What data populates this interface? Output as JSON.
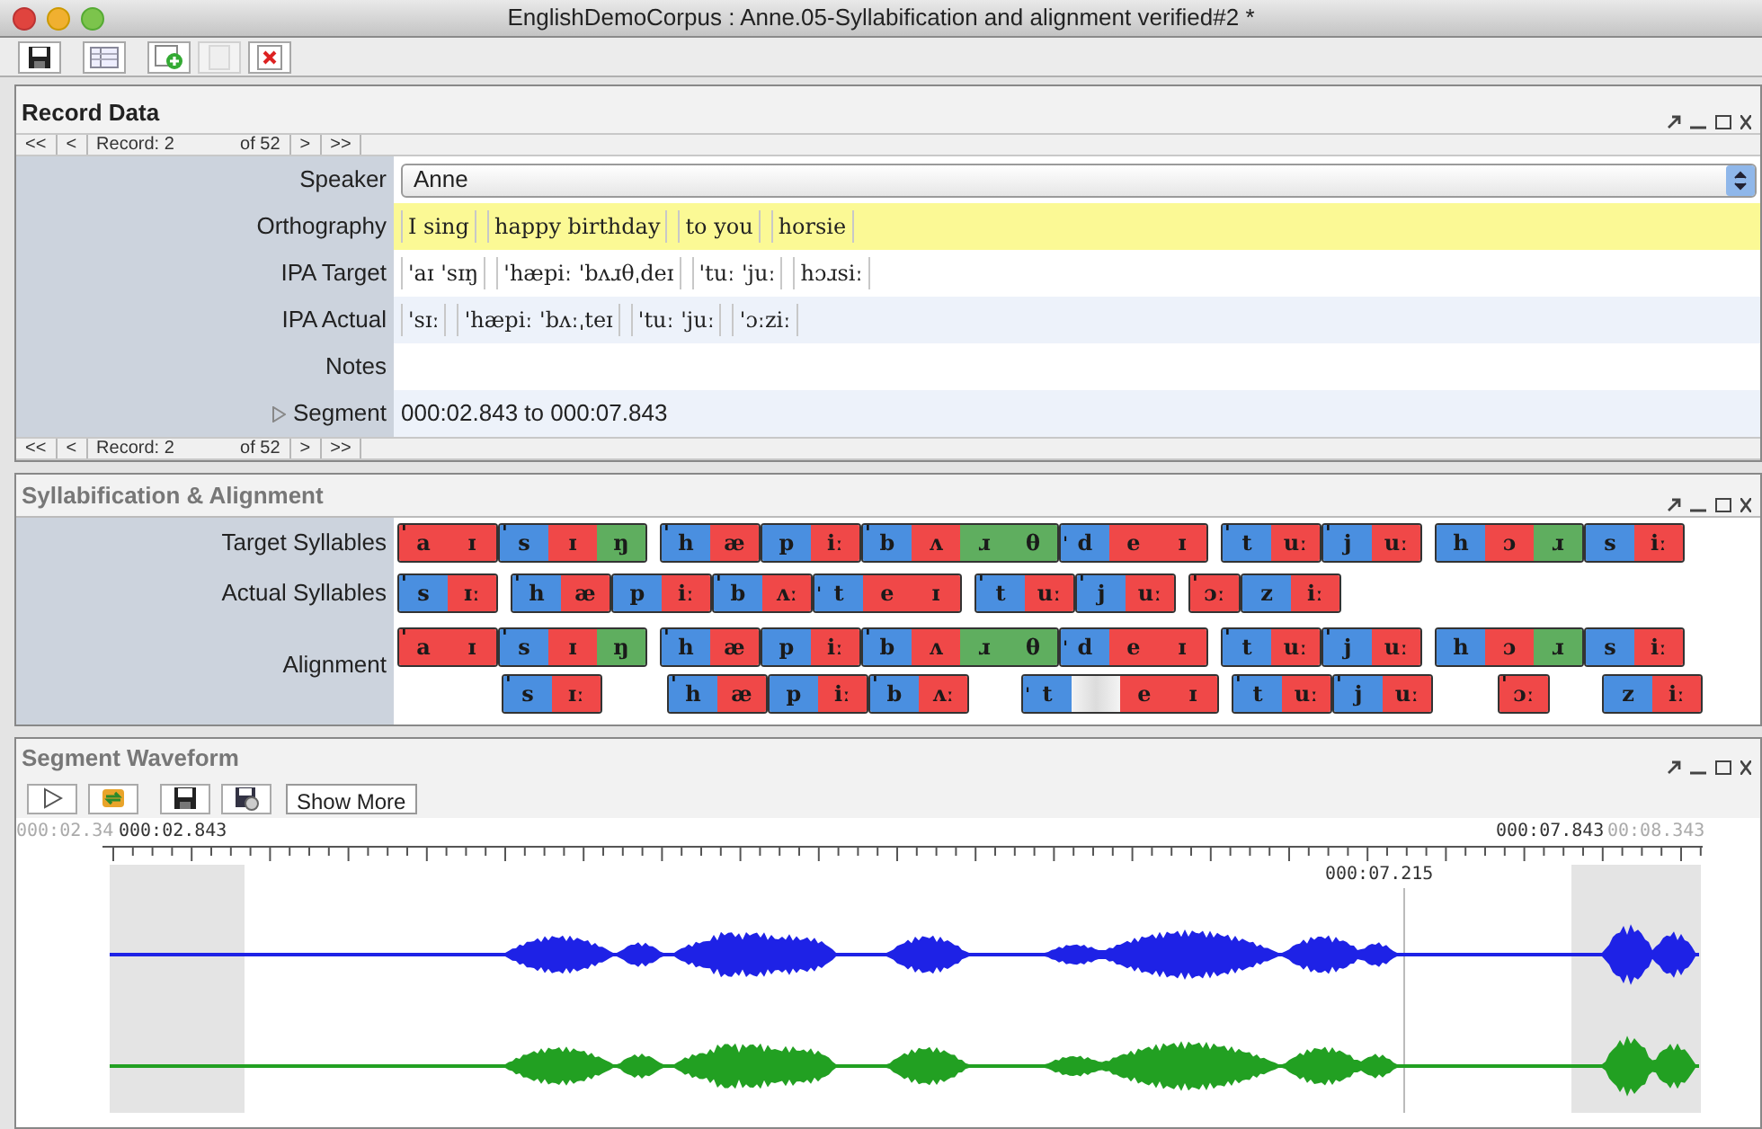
{
  "window": {
    "title": "EnglishDemoCorpus : Anne.05-Syllabification and alignment verified#2 *"
  },
  "toolbar": [
    {
      "kind": "save",
      "disabled": false
    },
    {
      "kind": "layout",
      "disabled": false
    },
    {
      "kind": "add",
      "disabled": false
    },
    {
      "kind": "document",
      "disabled": true
    },
    {
      "kind": "delete",
      "disabled": false
    }
  ],
  "record_panel": {
    "title": "Record Data",
    "nav_top": {
      "first": "<<",
      "prev": "<",
      "record": "Record: 2",
      "total": "of 52",
      "next": ">",
      "last": ">>"
    },
    "fields": [
      {
        "kind": "dropdown",
        "label": "Speaker",
        "value": "Anne",
        "highlighted": false
      },
      {
        "kind": "groups",
        "label": "Orthography",
        "groups": [
          "I sing",
          "happy birthday",
          "to you",
          "horsie"
        ],
        "highlighted": true
      },
      {
        "kind": "groups",
        "label": "IPA Target",
        "groups": [
          "'aɪ 'sɪŋ",
          "'hæpiː 'bʌɹθˌdeɪ",
          "'tuː 'juː",
          "hɔɹsiː"
        ],
        "highlighted": false
      },
      {
        "kind": "groups",
        "label": "IPA Actual",
        "groups": [
          "'sɪː",
          "'hæpiː 'bʌːˌteɪ",
          "'tuː 'juː",
          "'ɔːziː"
        ],
        "highlighted": false
      },
      {
        "kind": "text",
        "label": "Notes",
        "highlighted": false
      },
      {
        "kind": "segment",
        "label": "Segment",
        "value": "000:02.843 to 000:07.843",
        "expanded": false,
        "highlighted": false
      }
    ],
    "nav_bottom": {
      "first": "<<",
      "prev": "<",
      "record": "Record: 2",
      "total": "of 52",
      "next": ">",
      "last": ">>"
    }
  },
  "syllabification_panel": {
    "title": "Syllabification & Alignment",
    "target": {
      "label": "Target Syllables",
      "words": [
        [
          {
            "stress": "'",
            "phones": [
              {
                "text": "a",
                "color": "#f04848"
              },
              {
                "text": "ɪ",
                "color": "#f04848"
              }
            ]
          },
          {
            "stress": "'",
            "phones": [
              {
                "text": "s",
                "color": "#4a8fe0"
              },
              {
                "text": "ɪ",
                "color": "#f04848"
              },
              {
                "text": "ŋ",
                "color": "#5fae5f"
              }
            ]
          }
        ],
        [
          {
            "stress": "'",
            "phones": [
              {
                "text": "h",
                "color": "#4a8fe0"
              },
              {
                "text": "æ",
                "color": "#f04848"
              }
            ]
          },
          {
            "phones": [
              {
                "text": "p",
                "color": "#4a8fe0"
              },
              {
                "text": "iː",
                "color": "#f04848"
              }
            ]
          },
          {
            "stress": "'",
            "phones": [
              {
                "text": "b",
                "color": "#4a8fe0"
              },
              {
                "text": "ʌ",
                "color": "#f04848"
              },
              {
                "text": "ɹ",
                "color": "#5fae5f"
              },
              {
                "text": "θ",
                "color": "#5fae5f"
              }
            ]
          },
          {
            "stress": "ˌ",
            "phones": [
              {
                "text": "d",
                "color": "#4a8fe0"
              },
              {
                "text": "e",
                "color": "#f04848"
              },
              {
                "text": "ɪ",
                "color": "#f04848"
              }
            ]
          }
        ],
        [
          {
            "stress": "'",
            "phones": [
              {
                "text": "t",
                "color": "#4a8fe0"
              },
              {
                "text": "uː",
                "color": "#f04848"
              }
            ]
          },
          {
            "stress": "'",
            "phones": [
              {
                "text": "j",
                "color": "#4a8fe0"
              },
              {
                "text": "uː",
                "color": "#f04848"
              }
            ]
          }
        ],
        [
          {
            "phones": [
              {
                "text": "h",
                "color": "#4a8fe0"
              },
              {
                "text": "ɔ",
                "color": "#f04848"
              },
              {
                "text": "ɹ",
                "color": "#5fae5f"
              }
            ]
          },
          {
            "phones": [
              {
                "text": "s",
                "color": "#4a8fe0"
              },
              {
                "text": "iː",
                "color": "#f04848"
              }
            ]
          }
        ]
      ]
    },
    "actual": {
      "label": "Actual Syllables",
      "words": [
        [
          {
            "stress": "'",
            "phones": [
              {
                "text": "s",
                "color": "#4a8fe0"
              },
              {
                "text": "ɪː",
                "color": "#f04848"
              }
            ]
          }
        ],
        [
          {
            "stress": "'",
            "phones": [
              {
                "text": "h",
                "color": "#4a8fe0"
              },
              {
                "text": "æ",
                "color": "#f04848"
              }
            ]
          },
          {
            "phones": [
              {
                "text": "p",
                "color": "#4a8fe0"
              },
              {
                "text": "iː",
                "color": "#f04848"
              }
            ]
          },
          {
            "stress": "'",
            "phones": [
              {
                "text": "b",
                "color": "#4a8fe0"
              },
              {
                "text": "ʌː",
                "color": "#f04848"
              }
            ]
          },
          {
            "stress": "ˌ",
            "phones": [
              {
                "text": "t",
                "color": "#4a8fe0"
              },
              {
                "text": "e",
                "color": "#f04848"
              },
              {
                "text": "ɪ",
                "color": "#f04848"
              }
            ]
          }
        ],
        [
          {
            "stress": "'",
            "phones": [
              {
                "text": "t",
                "color": "#4a8fe0"
              },
              {
                "text": "uː",
                "color": "#f04848"
              }
            ]
          },
          {
            "stress": "'",
            "phones": [
              {
                "text": "j",
                "color": "#4a8fe0"
              },
              {
                "text": "uː",
                "color": "#f04848"
              }
            ]
          }
        ],
        [
          {
            "stress": "'",
            "phones": [
              {
                "text": "ɔː",
                "color": "#f04848"
              }
            ]
          },
          {
            "phones": [
              {
                "text": "z",
                "color": "#4a8fe0"
              },
              {
                "text": "iː",
                "color": "#f04848"
              }
            ]
          }
        ]
      ]
    },
    "alignment": {
      "label": "Alignment",
      "top": [
        [
          {
            "stress": "'",
            "phones": [
              {
                "text": "a",
                "color": "#f04848"
              },
              {
                "text": "ɪ",
                "color": "#f04848"
              }
            ]
          },
          {
            "stress": "'",
            "phones": [
              {
                "text": "s",
                "color": "#4a8fe0"
              },
              {
                "text": "ɪ",
                "color": "#f04848"
              },
              {
                "text": "ŋ",
                "color": "#5fae5f"
              }
            ]
          }
        ],
        [
          {
            "stress": "'",
            "phones": [
              {
                "text": "h",
                "color": "#4a8fe0"
              },
              {
                "text": "æ",
                "color": "#f04848"
              }
            ]
          },
          {
            "phones": [
              {
                "text": "p",
                "color": "#4a8fe0"
              },
              {
                "text": "iː",
                "color": "#f04848"
              }
            ]
          },
          {
            "stress": "'",
            "phones": [
              {
                "text": "b",
                "color": "#4a8fe0"
              },
              {
                "text": "ʌ",
                "color": "#f04848"
              },
              {
                "text": "ɹ",
                "color": "#5fae5f"
              },
              {
                "text": "θ",
                "color": "#5fae5f"
              }
            ]
          },
          {
            "stress": "ˌ",
            "phones": [
              {
                "text": "d",
                "color": "#4a8fe0"
              },
              {
                "text": "e",
                "color": "#f04848"
              },
              {
                "text": "ɪ",
                "color": "#f04848"
              }
            ]
          }
        ],
        [
          {
            "stress": "'",
            "phones": [
              {
                "text": "t",
                "color": "#4a8fe0"
              },
              {
                "text": "uː",
                "color": "#f04848"
              }
            ]
          },
          {
            "stress": "'",
            "phones": [
              {
                "text": "j",
                "color": "#4a8fe0"
              },
              {
                "text": "uː",
                "color": "#f04848"
              }
            ]
          }
        ],
        [
          {
            "phones": [
              {
                "text": "h",
                "color": "#4a8fe0"
              },
              {
                "text": "ɔ",
                "color": "#f04848"
              },
              {
                "text": "ɹ",
                "color": "#5fae5f"
              }
            ]
          },
          {
            "phones": [
              {
                "text": "s",
                "color": "#4a8fe0"
              },
              {
                "text": "iː",
                "color": "#f04848"
              }
            ]
          }
        ]
      ],
      "bottom": [
        [
          {
            "kind": "blank"
          },
          {
            "kind": "blank"
          },
          {
            "kind": "syllable",
            "stress": "'",
            "phones": [
              {
                "text": "s",
                "color": "#4a8fe0"
              },
              {
                "text": "ɪː",
                "color": "#f04848"
              }
            ]
          },
          {
            "kind": "blank"
          }
        ],
        [
          {
            "kind": "syllable",
            "stress": "'",
            "phones": [
              {
                "text": "h",
                "color": "#4a8fe0"
              },
              {
                "text": "æ",
                "color": "#f04848"
              }
            ]
          },
          {
            "kind": "syllable",
            "phones": [
              {
                "text": "p",
                "color": "#4a8fe0"
              },
              {
                "text": "iː",
                "color": "#f04848"
              }
            ]
          },
          {
            "kind": "syllable",
            "stress": "'",
            "phones": [
              {
                "text": "b",
                "color": "#4a8fe0"
              },
              {
                "text": "ʌː",
                "color": "#f04848"
              }
            ]
          },
          {
            "kind": "blank"
          },
          {
            "kind": "syllable",
            "stress": "ˌ",
            "phones": [
              {
                "text": "t",
                "color": "#4a8fe0"
              },
              {
                "kind": "gap"
              },
              {
                "text": "e",
                "color": "#f04848"
              },
              {
                "text": "ɪ",
                "color": "#f04848"
              }
            ]
          }
        ],
        [
          {
            "kind": "syllable",
            "stress": "'",
            "phones": [
              {
                "text": "t",
                "color": "#4a8fe0"
              },
              {
                "text": "uː",
                "color": "#f04848"
              }
            ]
          },
          {
            "kind": "syllable",
            "stress": "'",
            "phones": [
              {
                "text": "j",
                "color": "#4a8fe0"
              },
              {
                "text": "uː",
                "color": "#f04848"
              }
            ]
          }
        ],
        [
          {
            "kind": "blank"
          },
          {
            "kind": "syllable",
            "stress": "'",
            "phones": [
              {
                "text": "ɔː",
                "color": "#f04848"
              }
            ]
          },
          {
            "kind": "blank"
          },
          {
            "kind": "syllable",
            "phones": [
              {
                "text": "z",
                "color": "#4a8fe0"
              },
              {
                "text": "iː",
                "color": "#f04848"
              }
            ]
          }
        ]
      ]
    }
  },
  "waveform_panel": {
    "title": "Segment Waveform",
    "toolbar": [
      {
        "kind": "play"
      },
      {
        "kind": "refresh"
      },
      {
        "kind": "save"
      },
      {
        "kind": "export"
      },
      {
        "kind": "button",
        "label": "Show More"
      }
    ],
    "ruler": {
      "start_outer": "000:02.34",
      "start": "000:02.843",
      "end": "000:07.843",
      "end_outer": "00:08.343"
    },
    "cursor": "000:07.215"
  }
}
